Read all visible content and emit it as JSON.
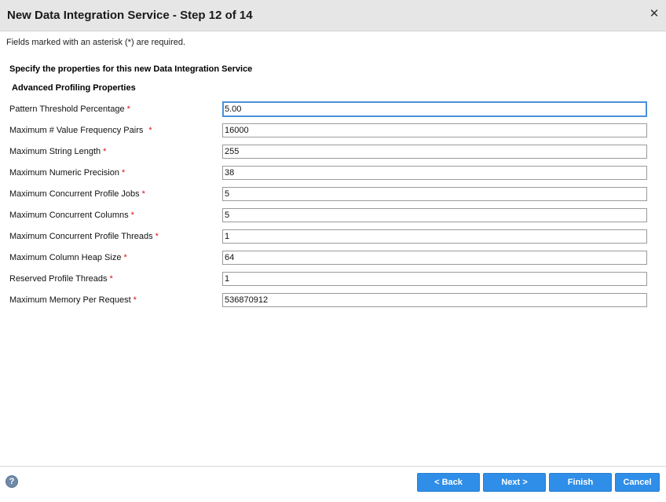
{
  "dialog": {
    "title": "New Data Integration Service - Step 12 of 14",
    "close_glyph": "✕",
    "required_note": "Fields marked with an asterisk (*) are required."
  },
  "form": {
    "heading": "Specify the properties for this new Data Integration Service",
    "subheading": "Advanced Profiling Properties",
    "required_marker": "*",
    "fields": [
      {
        "label": "Pattern Threshold Percentage",
        "value": "5.00"
      },
      {
        "label": "Maximum # Value Frequency Pairs",
        "value": "16000"
      },
      {
        "label": "Maximum String Length",
        "value": "255"
      },
      {
        "label": "Maximum Numeric Precision",
        "value": "38"
      },
      {
        "label": "Maximum Concurrent Profile Jobs",
        "value": "5"
      },
      {
        "label": "Maximum Concurrent Columns",
        "value": "5"
      },
      {
        "label": "Maximum Concurrent Profile Threads",
        "value": "1"
      },
      {
        "label": "Maximum Column Heap Size",
        "value": "64"
      },
      {
        "label": "Reserved Profile Threads",
        "value": "1"
      },
      {
        "label": "Maximum Memory Per Request",
        "value": "536870912"
      }
    ]
  },
  "footer": {
    "help_glyph": "?",
    "help_icon": "help-icon",
    "back_label": "< Back",
    "next_label": "Next >",
    "finish_label": "Finish",
    "cancel_label": "Cancel"
  },
  "colors": {
    "button": "#2f8ee8",
    "required": "#dd1111",
    "focus": "#4a90d9",
    "titlebar": "#e6e6e6"
  }
}
